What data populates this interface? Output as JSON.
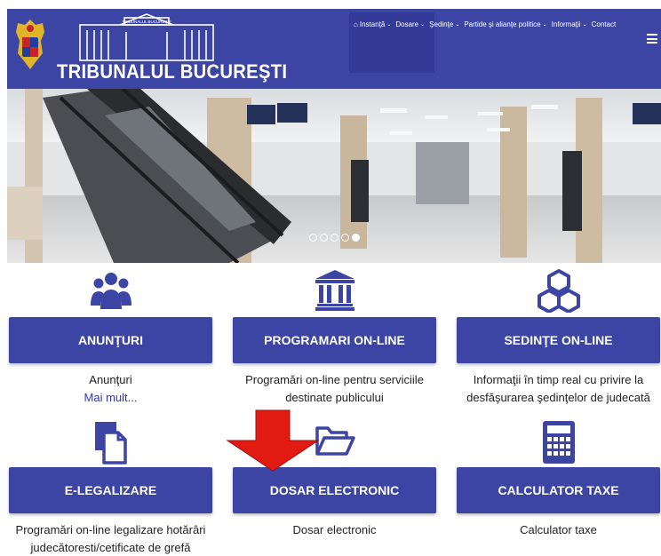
{
  "header": {
    "brand": "TRIBUNALUL BUCUREŞTI",
    "building_sign": "TRIBUNALUL BUCUREŞTI",
    "nav": [
      {
        "label": "Instanţă",
        "icon": "home-icon"
      },
      {
        "label": "Dosare"
      },
      {
        "label": "Şedinţe"
      },
      {
        "label": "Partide şi alianţe politice"
      },
      {
        "label": "Informaţii"
      },
      {
        "label": "Contact"
      }
    ]
  },
  "carousel": {
    "slide_count": 5,
    "active_index": 4
  },
  "cards": [
    {
      "icon": "users-icon",
      "label": "ANUNŢURI",
      "desc": "Anunţuri",
      "link": "Mai mult..."
    },
    {
      "icon": "bank-icon",
      "label": "PROGRAMARI ON-LINE",
      "desc": "Programări on-line pentru serviciile destinate publicului"
    },
    {
      "icon": "cubes-icon",
      "label": "SEDINŢE ON-LINE",
      "desc": "Informaţii în timp real cu privire la desfăşurarea şedinţelor de judecată"
    },
    {
      "icon": "document-icon",
      "label": "E-LEGALIZARE",
      "desc": "Programări on-line legalizare hotărâri judecătoresti/cetificate de grefă"
    },
    {
      "icon": "folder-open-icon",
      "label": "DOSAR ELECTRONIC",
      "desc": "Dosar electronic"
    },
    {
      "icon": "calculator-icon",
      "label": "CALCULATOR TAXE",
      "desc": "Calculator taxe"
    }
  ],
  "colors": {
    "primary": "#3d45a4",
    "link": "#2f39b5",
    "arrow": "#e11b12"
  }
}
